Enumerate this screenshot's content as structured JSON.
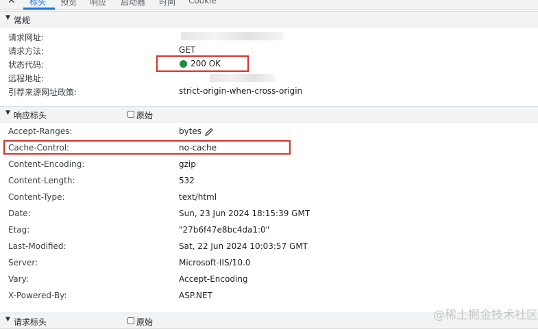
{
  "toolbar": {
    "close_label": "✕",
    "tabs": [
      {
        "label": "标头",
        "active": true
      },
      {
        "label": "预览",
        "active": false
      },
      {
        "label": "响应",
        "active": false
      },
      {
        "label": "启动器",
        "active": false
      },
      {
        "label": "时间",
        "active": false
      },
      {
        "label": "Cookie",
        "active": false
      }
    ]
  },
  "general": {
    "title": "常规",
    "rows": [
      {
        "key": "请求网址:",
        "value": ""
      },
      {
        "key": "请求方法:",
        "value": "GET"
      },
      {
        "key": "状态代码:",
        "value": "200 OK"
      },
      {
        "key": "远程地址:",
        "value": ""
      },
      {
        "key": "引荐来源网址政策:",
        "value": "strict-origin-when-cross-origin"
      }
    ]
  },
  "response_headers": {
    "title": "响应标头",
    "raw_label": "原始",
    "rows": [
      {
        "key": "Accept-Ranges:",
        "value": "bytes"
      },
      {
        "key": "Cache-Control:",
        "value": "no-cache"
      },
      {
        "key": "Content-Encoding:",
        "value": "gzip"
      },
      {
        "key": "Content-Length:",
        "value": "532"
      },
      {
        "key": "Content-Type:",
        "value": "text/html"
      },
      {
        "key": "Date:",
        "value": "Sun, 23 Jun 2024 18:15:39 GMT"
      },
      {
        "key": "Etag:",
        "value": "\"27b6f47e8bc4da1:0\""
      },
      {
        "key": "Last-Modified:",
        "value": "Sat, 22 Jun 2024 10:03:57 GMT"
      },
      {
        "key": "Server:",
        "value": "Microsoft-IIS/10.0"
      },
      {
        "key": "Vary:",
        "value": "Accept-Encoding"
      },
      {
        "key": "X-Powered-By:",
        "value": "ASP.NET"
      }
    ]
  },
  "request_headers": {
    "title": "请求标头",
    "raw_label": "原始"
  },
  "watermark": "@稀土掘金技术社区",
  "colors": {
    "accent": "#1a73e8",
    "status_ok": "#1e8e3e",
    "highlight_box": "#d93025"
  }
}
